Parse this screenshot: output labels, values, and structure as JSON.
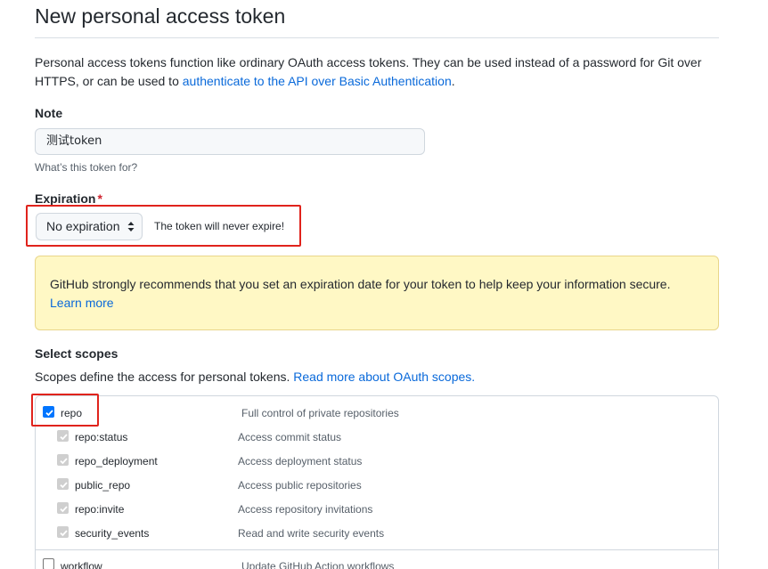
{
  "page": {
    "title": "New personal access token",
    "intro_text": "Personal access tokens function like ordinary OAuth access tokens. They can be used instead of a password for Git over HTTPS, or can be used to ",
    "intro_link": "authenticate to the API over Basic Authentication",
    "intro_end": "."
  },
  "note": {
    "label": "Note",
    "value": "测试token",
    "hint": "What’s this token for?"
  },
  "expiration": {
    "label": "Expiration",
    "required_mark": "*",
    "selected": "No expiration",
    "note": "The token will never expire!"
  },
  "flash": {
    "text": "GitHub strongly recommends that you set an expiration date for your token to help keep your information secure.",
    "link": "Learn more"
  },
  "scopes": {
    "title": "Select scopes",
    "desc": "Scopes define the access for personal tokens. ",
    "desc_link": "Read more about OAuth scopes.",
    "items": [
      {
        "name": "repo",
        "desc": "Full control of private repositories",
        "checked": true
      },
      {
        "name": "repo:status",
        "desc": "Access commit status",
        "checked": true
      },
      {
        "name": "repo_deployment",
        "desc": "Access deployment status",
        "checked": true
      },
      {
        "name": "public_repo",
        "desc": "Access public repositories",
        "checked": true
      },
      {
        "name": "repo:invite",
        "desc": "Access repository invitations",
        "checked": true
      },
      {
        "name": "security_events",
        "desc": "Read and write security events",
        "checked": true
      },
      {
        "name": "workflow",
        "desc": "Update GitHub Action workflows",
        "checked": false
      }
    ]
  },
  "colors": {
    "link": "#0969da",
    "highlight_box": "#e0231c",
    "flash_bg": "#fff8c5",
    "checkbox_checked": "#0075ff"
  }
}
